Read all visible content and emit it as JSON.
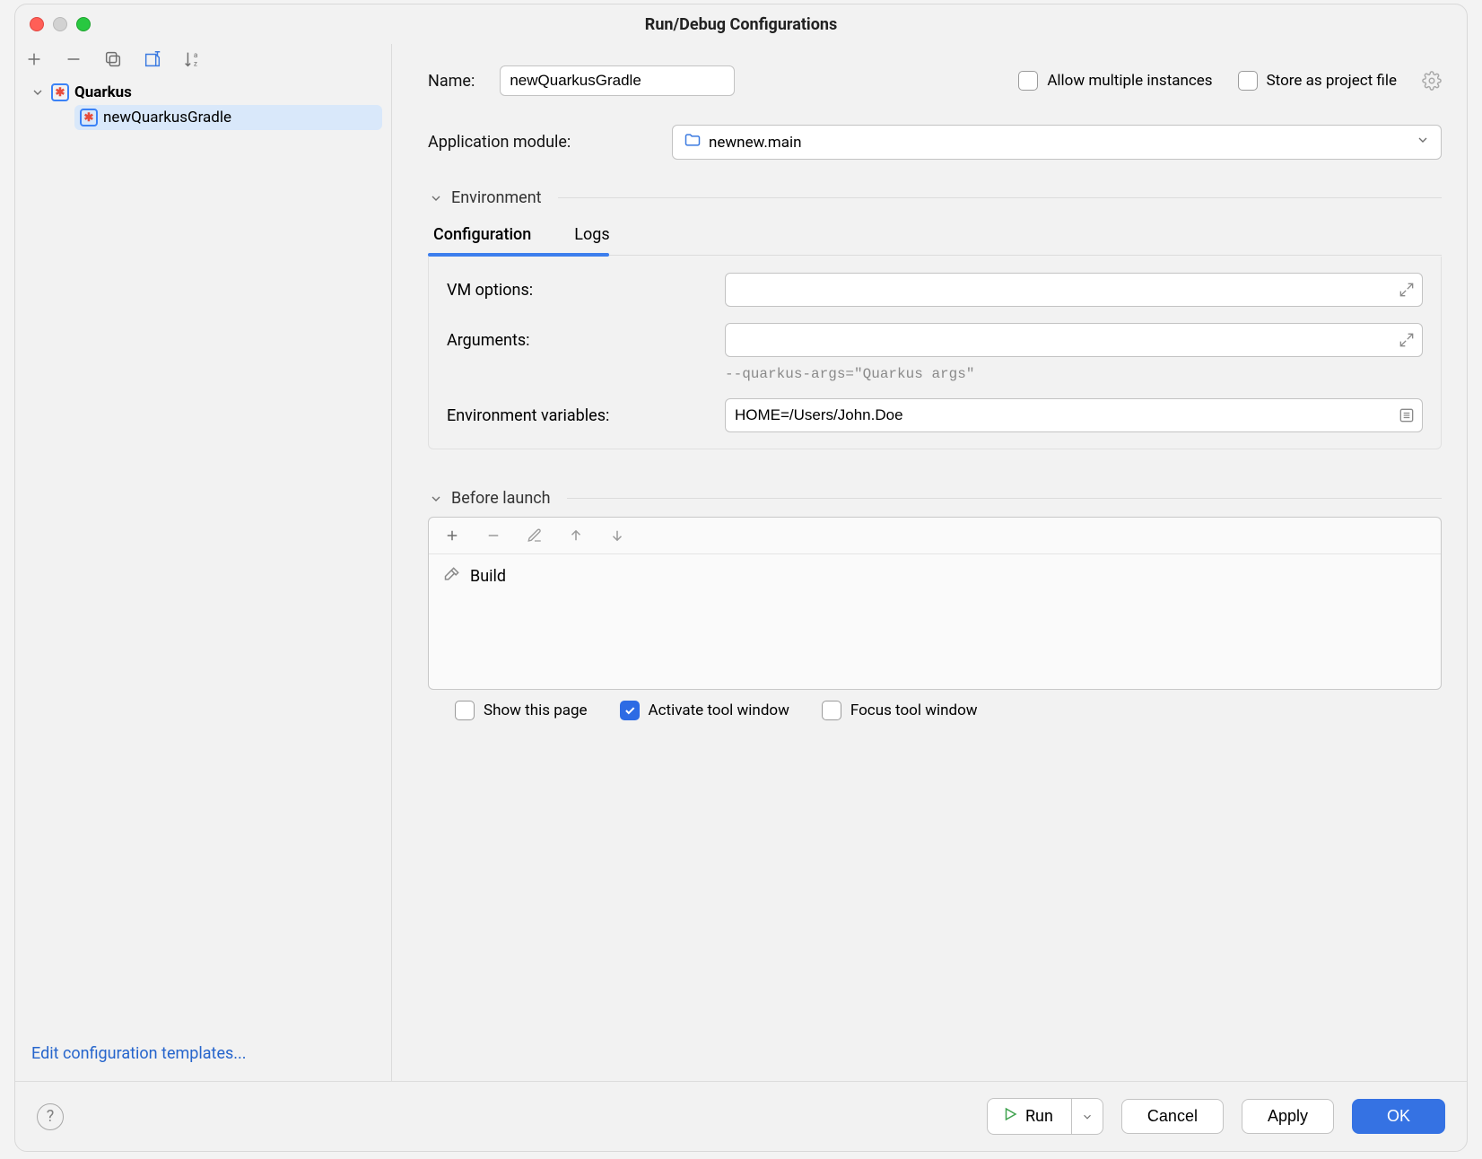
{
  "title": "Run/Debug Configurations",
  "sidebar": {
    "root_label": "Quarkus",
    "selected_label": "newQuarkusGradle",
    "edit_templates_label": "Edit configuration templates..."
  },
  "main": {
    "name_label": "Name:",
    "name_value": "newQuarkusGradle",
    "allow_multiple_label": "Allow multiple instances",
    "allow_multiple_checked": false,
    "store_project_label": "Store as project file",
    "store_project_checked": false,
    "module_label": "Application module:",
    "module_value": "newnew.main",
    "environment_section": "Environment",
    "tabs": {
      "config": "Configuration",
      "logs": "Logs"
    },
    "vm_options_label": "VM options:",
    "vm_options_value": "",
    "arguments_label": "Arguments:",
    "arguments_value": "",
    "arguments_hint": "--quarkus-args=\"Quarkus args\"",
    "env_vars_label": "Environment variables:",
    "env_vars_value": "HOME=/Users/John.Doe",
    "before_launch_section": "Before launch",
    "before_launch_item": "Build",
    "show_page_label": "Show this page",
    "show_page_checked": false,
    "activate_tool_label": "Activate tool window",
    "activate_tool_checked": true,
    "focus_tool_label": "Focus tool window",
    "focus_tool_checked": false
  },
  "footer": {
    "run": "Run",
    "cancel": "Cancel",
    "apply": "Apply",
    "ok": "OK"
  }
}
